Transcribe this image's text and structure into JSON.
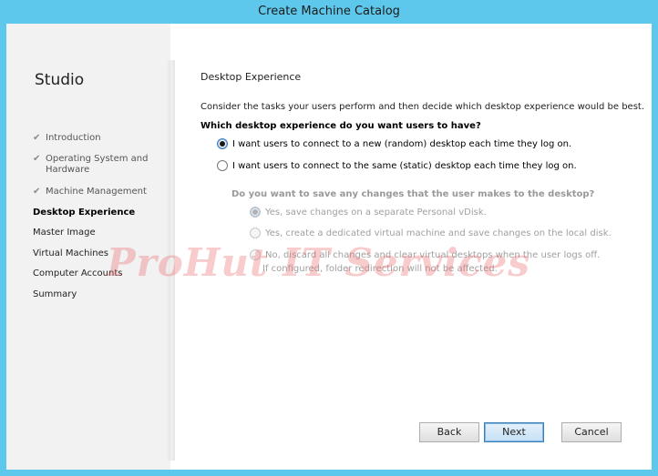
{
  "window": {
    "title": "Create Machine Catalog"
  },
  "sidebar": {
    "app_name": "Studio",
    "items": [
      {
        "label": "Introduction",
        "done": true
      },
      {
        "label": "Operating System and Hardware",
        "done": true
      },
      {
        "label": "Machine Management",
        "done": true
      },
      {
        "label": "Desktop Experience",
        "current": true
      },
      {
        "label": "Master Image"
      },
      {
        "label": "Virtual Machines"
      },
      {
        "label": "Computer Accounts"
      },
      {
        "label": "Summary"
      }
    ]
  },
  "main": {
    "section_title": "Desktop Experience",
    "intro": "Consider the tasks your users perform and then decide which desktop experience would be best.",
    "question": "Which desktop experience do you want users to have?",
    "options": [
      {
        "label": "I want users to connect to a new (random) desktop each time they log on.",
        "selected": true
      },
      {
        "label": "I want users to connect to the same (static) desktop each time they log on.",
        "selected": false
      }
    ],
    "sub_question": "Do you want to save any changes that the user makes to the desktop?",
    "sub_options": [
      {
        "label": "Yes, save changes on a separate Personal vDisk.",
        "selected": true
      },
      {
        "label": "Yes, create a dedicated virtual machine and save changes on the local disk.",
        "selected": false
      },
      {
        "label": "No, discard all changes and clear virtual desktops when the user logs off.",
        "selected": false
      }
    ],
    "sub_note": "If configured, folder redirection will not be affected.",
    "watermark": "ProHut IT Services"
  },
  "footer": {
    "back_label": "Back",
    "next_label": "Next",
    "cancel_label": "Cancel"
  }
}
